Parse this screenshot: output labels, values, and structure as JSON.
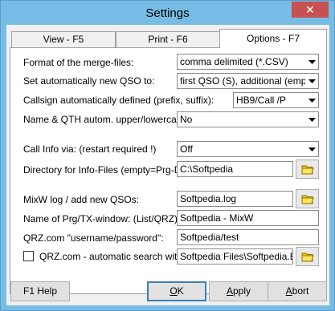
{
  "window": {
    "title": "Settings",
    "close_glyph": "✕"
  },
  "tabs": [
    {
      "label": "View - F5",
      "active": false
    },
    {
      "label": "Print - F6",
      "active": false
    },
    {
      "label": "Options - F7",
      "active": true
    }
  ],
  "rows": {
    "merge_format": {
      "label": "Format of the merge-files:",
      "value": "comma delimited (*.CSV)"
    },
    "auto_qso": {
      "label": "Set automatically new QSO to:",
      "value": "first QSO (S), additional (empty)"
    },
    "callsign_auto": {
      "label": "Callsign automatically defined  (prefix, suffix):",
      "value": "HB9/Call  /P"
    },
    "name_qth_case": {
      "label": "Name & QTH autom. upper/lowercase:",
      "value": "No"
    },
    "call_info": {
      "label": "Call Info via: (restart required !)",
      "value": "Off"
    },
    "info_dir": {
      "label": "Directory for Info-Files (empty=Prg-Dir) ?",
      "value": "C:\\Softpedia"
    },
    "mixw_log": {
      "label": "MixW log / add new QSOs:",
      "value": "Softpedia.log"
    },
    "prg_window": {
      "label": "Name of Prg/TX-window:  (List/QRZ)",
      "value": "Softpedia - MixW"
    },
    "qrz_login": {
      "label": "QRZ.com \"username/password\":",
      "value": "Softpedia/test"
    },
    "qrz_search": {
      "label": "QRZ.com - automatic search with:",
      "value": "Softpedia Files\\Softpedia.EXE",
      "checked": false
    }
  },
  "buttons": {
    "help": "F1 Help",
    "ok_underlined": "O",
    "ok_rest": "K",
    "apply_underlined": "A",
    "apply_rest": "pply",
    "abort_underlined": "A",
    "abort_rest": "bort"
  },
  "colors": {
    "titlebar": "#77bce4",
    "close": "#c75050",
    "folder": "#f5d200"
  }
}
